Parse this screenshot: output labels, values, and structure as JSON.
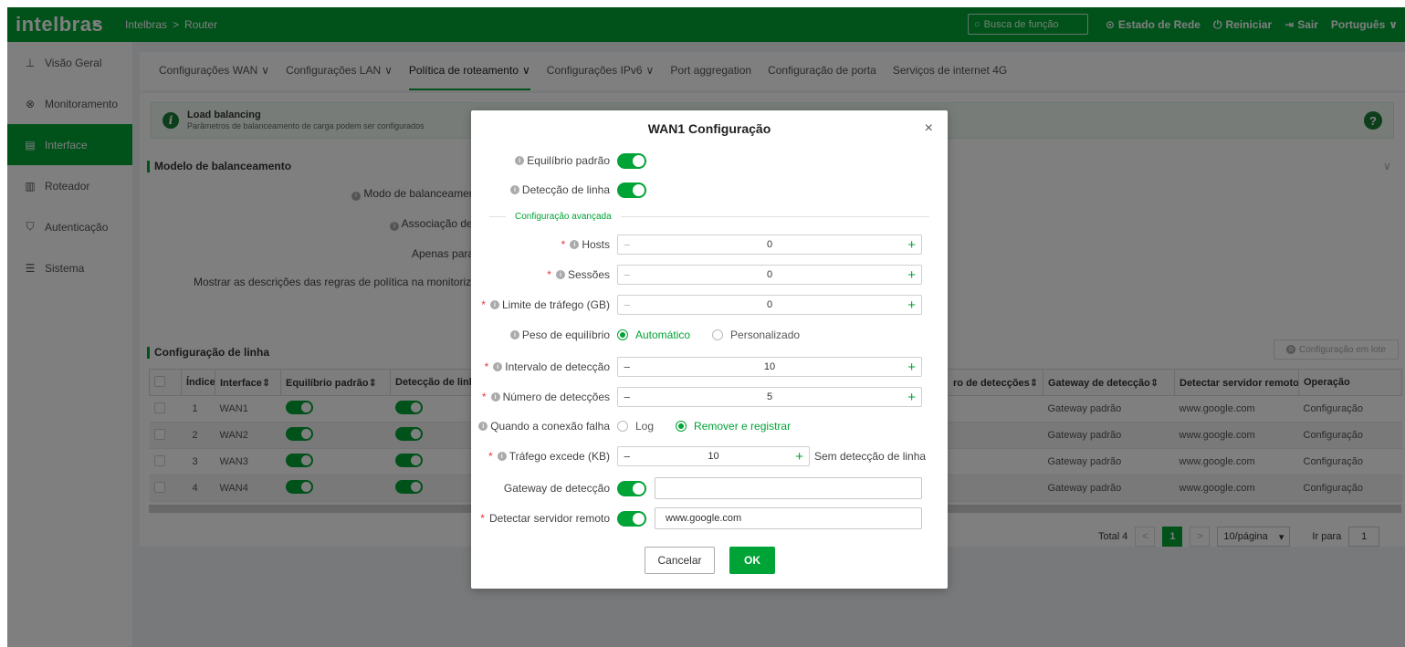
{
  "colors": {
    "brand": "#00a335",
    "danger": "#e53935"
  },
  "topbar": {
    "logo": "intelbras",
    "breadcrumb": [
      "Intelbras",
      "Router"
    ],
    "breadcrumb_sep": ">",
    "search_placeholder": "Busca de função",
    "network_status": "Estado de Rede",
    "restart": "Reiniciar",
    "logout": "Sair",
    "language": "Português"
  },
  "sidebar": {
    "items": [
      {
        "label": "Visão Geral",
        "icon": "network-tree-icon"
      },
      {
        "label": "Monitoramento",
        "icon": "monitor-icon"
      },
      {
        "label": "Interface",
        "icon": "interface-icon",
        "active": true
      },
      {
        "label": "Roteador",
        "icon": "router-icon"
      },
      {
        "label": "Autenticação",
        "icon": "shield-icon"
      },
      {
        "label": "Sistema",
        "icon": "settings-icon"
      }
    ]
  },
  "tabs": [
    {
      "label": "Configurações WAN",
      "dropdown": true
    },
    {
      "label": "Configurações LAN",
      "dropdown": true
    },
    {
      "label": "Política de roteamento",
      "dropdown": true,
      "active": true
    },
    {
      "label": "Configurações IPv6",
      "dropdown": true
    },
    {
      "label": "Port aggregation"
    },
    {
      "label": "Configuração de porta"
    },
    {
      "label": "Serviços de internet 4G"
    }
  ],
  "banner": {
    "title": "Load balancing",
    "subtitle": "Parâmetros de balanceamento de carga podem ser configurados",
    "help": "?"
  },
  "balance_section": {
    "title": "Modelo de balanceamento",
    "labels": [
      "Modo de balanceamen",
      "Associação de",
      "Apenas para b",
      "Mostrar as descrições das regras de política na monitorização"
    ]
  },
  "line_section": {
    "title": "Configuração de linha",
    "bulk_button": "Configuração em lote",
    "columns": [
      "Índice",
      "Interface",
      "Equilíbrio padrão",
      "Detecção de linh",
      "ro de detecções",
      "Gateway de detecção",
      "Detectar servidor remoto",
      "Operação"
    ],
    "rows": [
      {
        "index": "1",
        "interface": "WAN1",
        "gateway": "Gateway padrão",
        "server": "www.google.com",
        "action": "Configuração"
      },
      {
        "index": "2",
        "interface": "WAN2",
        "gateway": "Gateway padrão",
        "server": "www.google.com",
        "action": "Configuração"
      },
      {
        "index": "3",
        "interface": "WAN3",
        "gateway": "Gateway padrão",
        "server": "www.google.com",
        "action": "Configuração"
      },
      {
        "index": "4",
        "interface": "WAN4",
        "gateway": "Gateway padrão",
        "server": "www.google.com",
        "action": "Configuração"
      }
    ],
    "pager": {
      "total": "Total 4",
      "current_page": "1",
      "page_size": "10/página",
      "jump_label": "Ir para",
      "jump_value": "1"
    }
  },
  "modal": {
    "title": "WAN1 Configuração",
    "close": "×",
    "balance_default": {
      "label": "Equilíbrio padrão",
      "enabled": true
    },
    "line_detection": {
      "label": "Detecção de linha",
      "enabled": true
    },
    "advanced_label": "Configuração avançada",
    "hosts": {
      "label": "Hosts",
      "value": "0"
    },
    "sessions": {
      "label": "Sessões",
      "value": "0"
    },
    "traffic_limit": {
      "label": "Limite de tráfego (GB)",
      "value": "0"
    },
    "balance_weight": {
      "label": "Peso de equilíbrio",
      "options": [
        "Automático",
        "Personalizado"
      ],
      "selected": "Automático"
    },
    "detect_interval": {
      "label": "Intervalo de detecção",
      "value": "10"
    },
    "detect_count": {
      "label": "Número de detecções",
      "value": "5"
    },
    "on_fail": {
      "label": "Quando a conexão falha",
      "options": [
        "Log",
        "Remover e registrar"
      ],
      "selected": "Remover e registrar"
    },
    "traffic_exceeds": {
      "label": "Tráfego excede (KB)",
      "value": "10",
      "suffix": "Sem detecção de linha"
    },
    "detect_gateway": {
      "label": "Gateway de detecção",
      "enabled": true,
      "value": ""
    },
    "remote_server": {
      "label": "Detectar servidor remoto",
      "enabled": true,
      "value": "www.google.com"
    },
    "cancel": "Cancelar",
    "ok": "OK"
  }
}
